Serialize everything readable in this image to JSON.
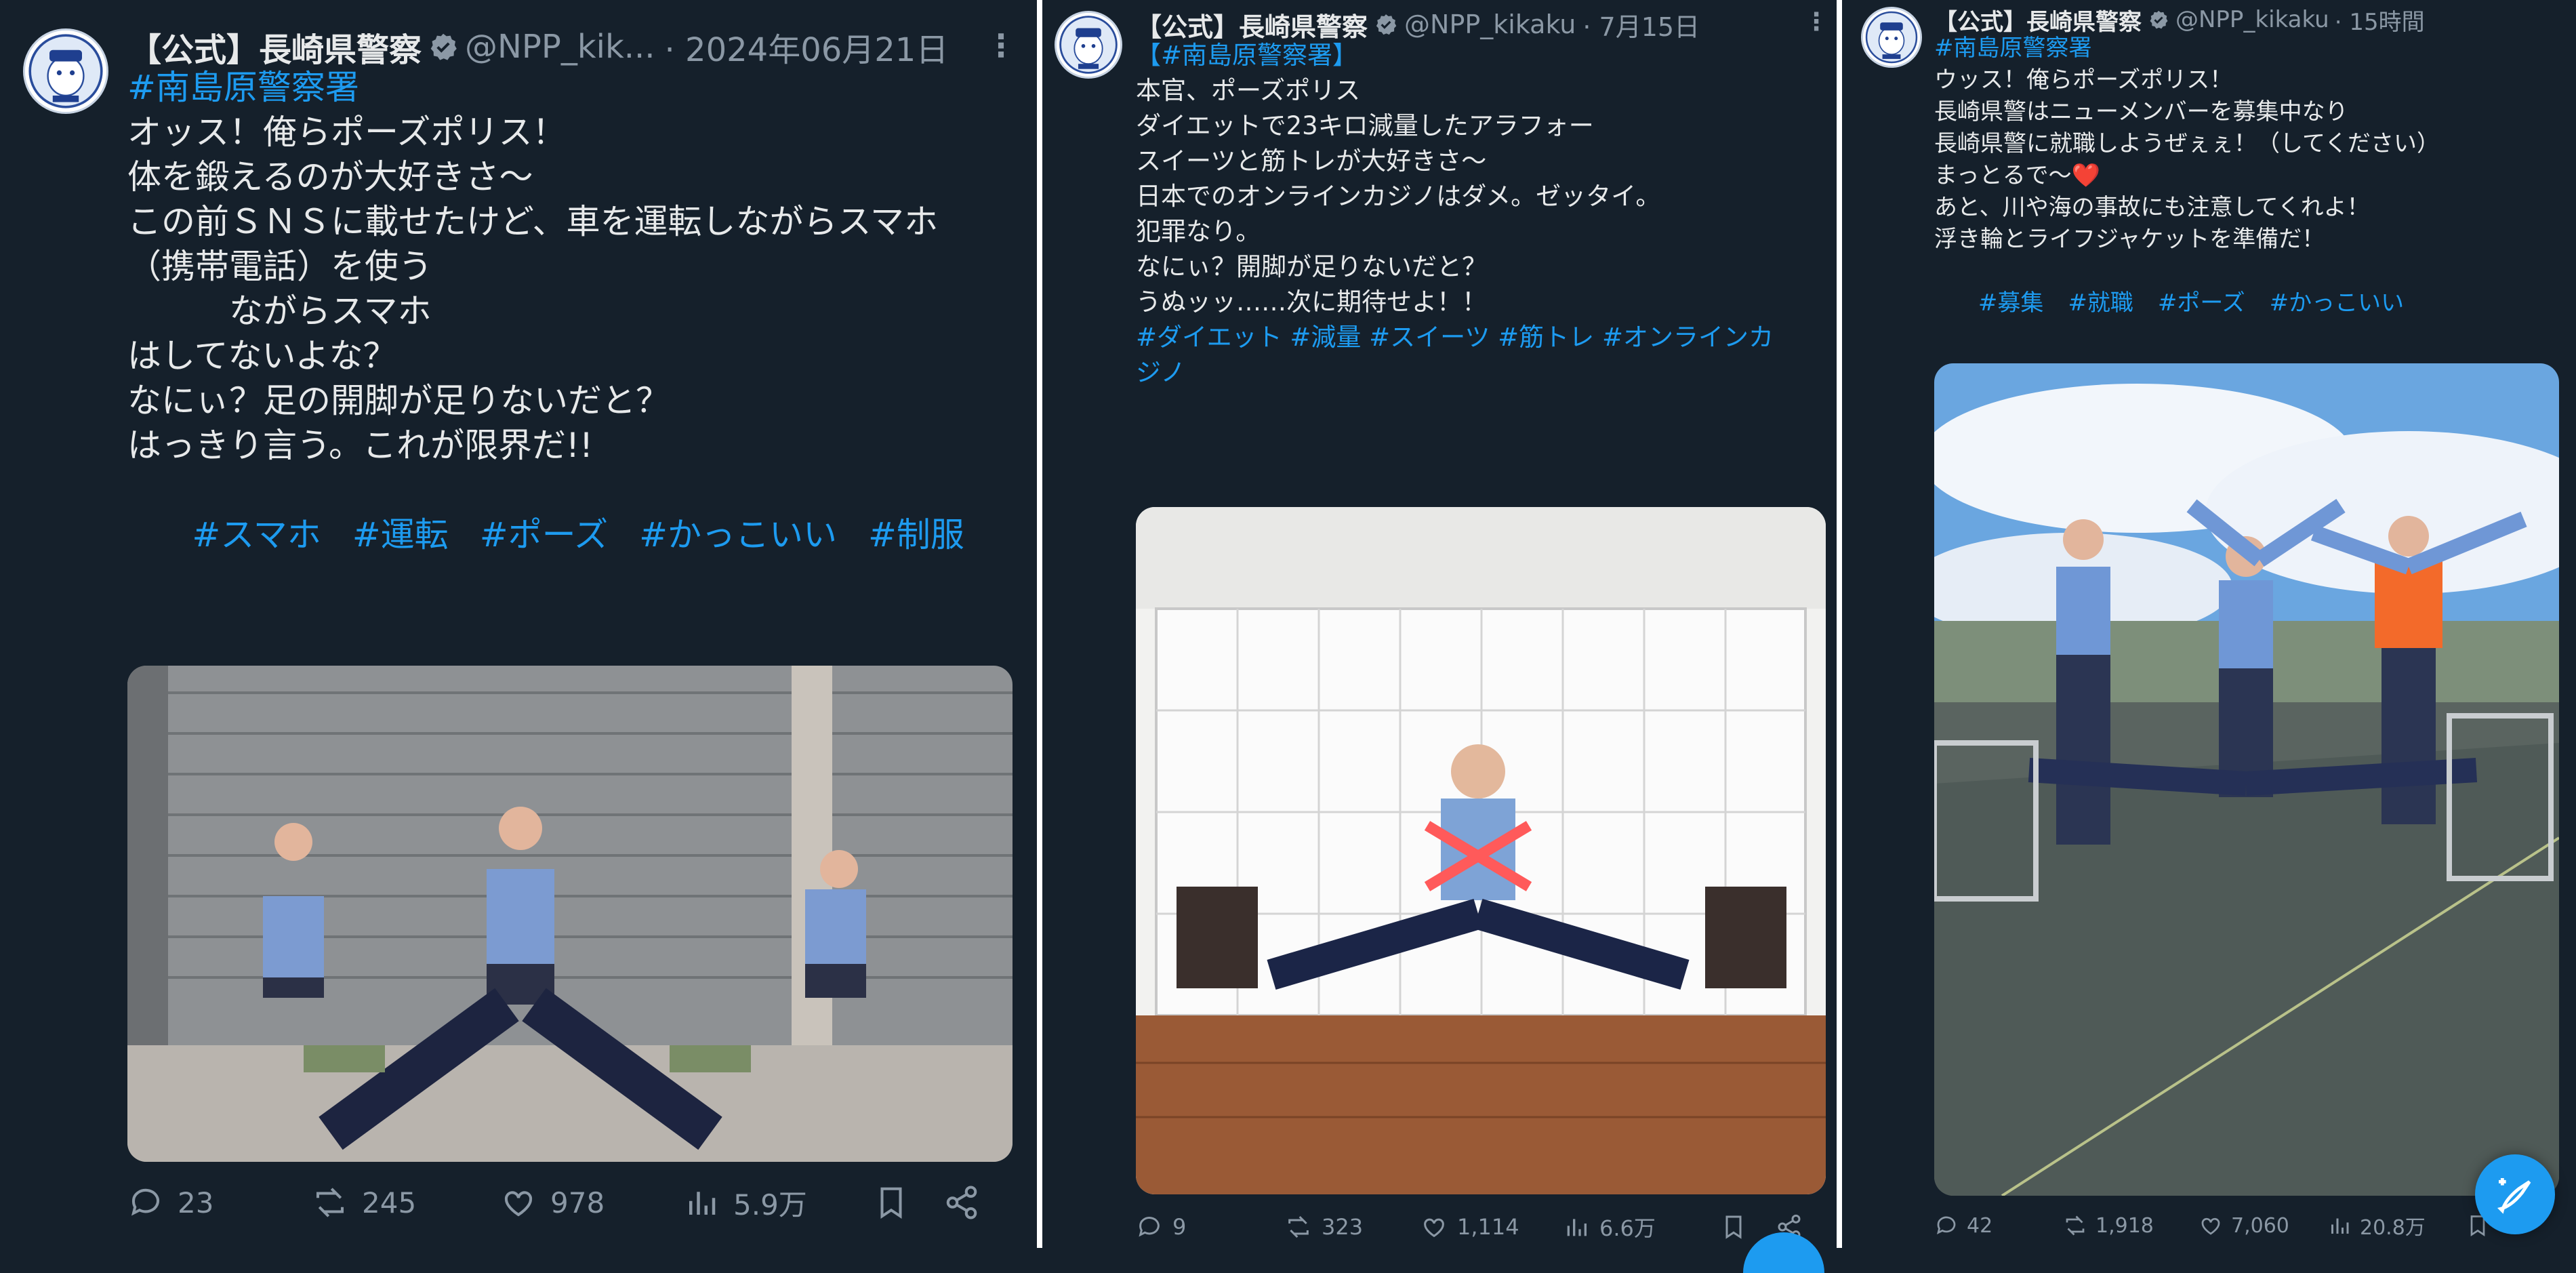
{
  "colors": {
    "background": "#15202b",
    "text": "#e7e9ea",
    "muted": "#8b98a5",
    "link": "#1d9bf0"
  },
  "tweets": [
    {
      "account_name": "【公式】長崎県警察",
      "handle": "@NPP_kik...",
      "date": "· 2024年06月21日",
      "lines": [
        "#南島原警察署",
        "オッス！俺らポーズポリス！",
        "体を鍛えるのが大好きさ〜",
        "",
        "この前ＳＮＳに載せたけど、車を運転しながらスマホ",
        "（携帯電話）を使う",
        "　　　ながらスマホ",
        "はしてないよな？",
        "",
        "なにぃ？足の開脚が足りないだと？",
        "はっきり言う。これが限界だ!!",
        ""
      ],
      "hashtags": [
        "#スマホ",
        "#運転",
        "#ポーズ",
        "#かっこいい",
        "#制服"
      ],
      "stats": {
        "replies": "23",
        "reposts": "245",
        "likes": "978",
        "views": "5.9万"
      }
    },
    {
      "account_name": "【公式】長崎県警察",
      "handle": "@NPP_kikaku",
      "date": "· 7月15日",
      "lines": [
        "【#南島原警察署】",
        "本官、ポーズポリス",
        "ダイエットで23キロ減量したアラフォー",
        "スイーツと筋トレが大好きさ〜",
        "",
        "日本でのオンラインカジノはダメ。ゼッタイ。",
        "犯罪なり。",
        "",
        "なにぃ？開脚が足りないだと？",
        "うぬッッ‥‥‥次に期待せよ！！",
        ""
      ],
      "hashtags": [
        "#ダイエット #減量 #スイーツ #筋トレ #オンラインカ",
        "ジノ"
      ],
      "stats": {
        "replies": "9",
        "reposts": "323",
        "likes": "1,114",
        "views": "6.6万"
      }
    },
    {
      "account_name": "【公式】長崎県警察",
      "handle": "@NPP_kikaku",
      "date": "· 15時間",
      "lines": [
        "#南島原警察署",
        "ウッス！俺らポーズポリス！",
        "長崎県警はニューメンバーを募集中なり",
        "長崎県警に就職しようぜぇぇ！（してください）",
        "まっとるで〜❤️",
        "",
        "あと、川や海の事故にも注意してくれよ！",
        "浮き輪とライフジャケットを準備だ！",
        ""
      ],
      "hashtags": [
        "#募集",
        "#就職",
        "#ポーズ",
        "#かっこいい"
      ],
      "stats": {
        "replies": "42",
        "reposts": "1,918",
        "likes": "7,060",
        "views": "20.8万"
      }
    }
  ],
  "icons": {
    "verified": "verified-badge-icon",
    "more": "more-options-icon",
    "reply": "reply-icon",
    "repost": "repost-icon",
    "like": "like-icon",
    "views": "views-icon",
    "bookmark": "bookmark-icon",
    "share": "share-icon",
    "compose": "compose-post-icon"
  }
}
